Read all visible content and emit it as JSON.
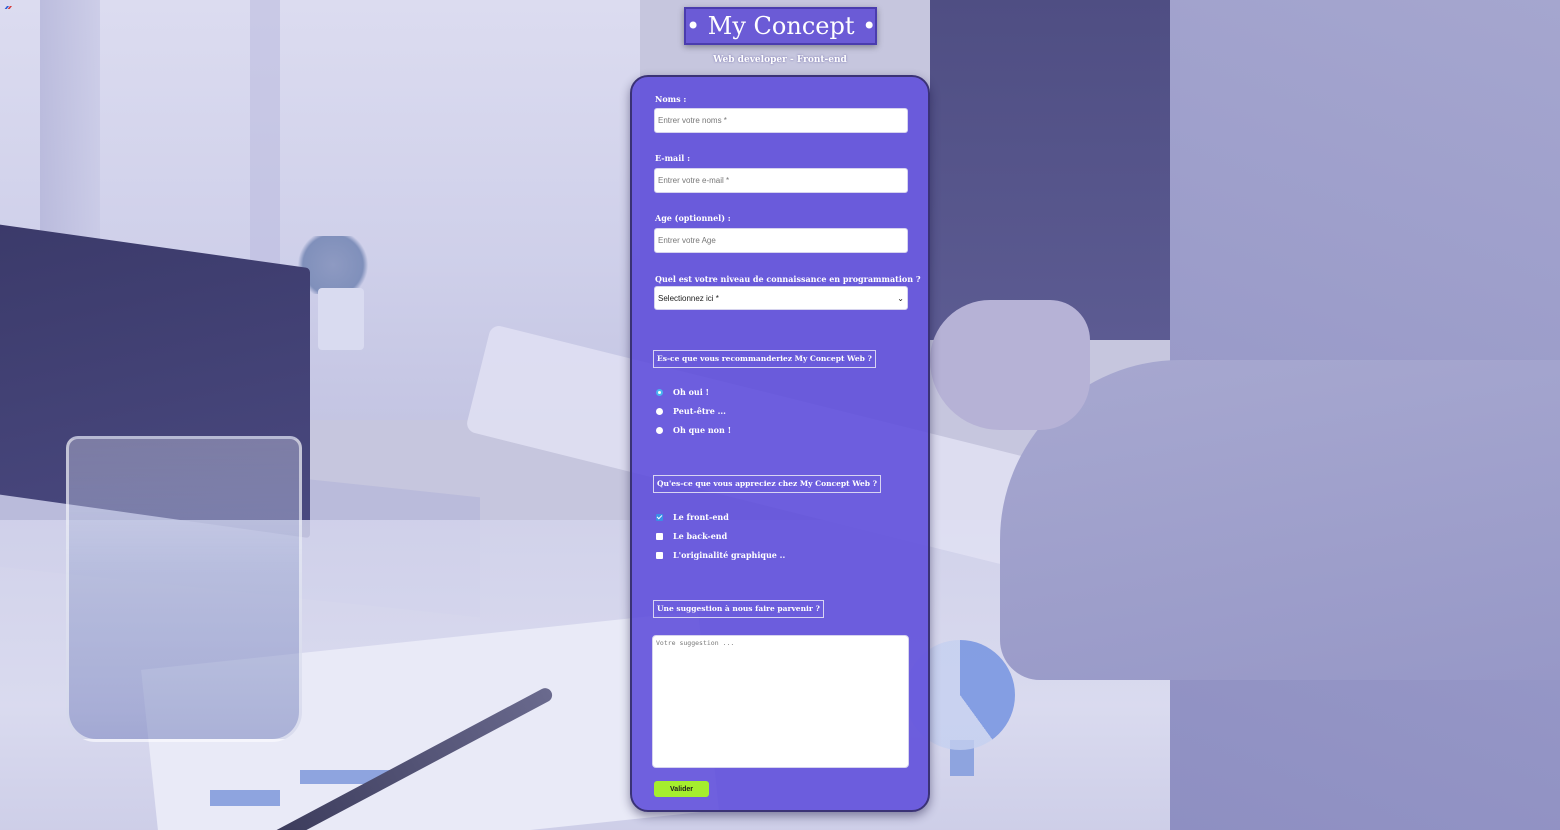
{
  "brand": {
    "title": "• My Concept •",
    "subtitle": "Web developer - Front-end"
  },
  "form": {
    "name": {
      "label": "Noms :",
      "placeholder": "Entrer votre noms *",
      "value": ""
    },
    "email": {
      "label": "E-mail :",
      "placeholder": "Entrer votre e-mail *",
      "value": ""
    },
    "age": {
      "label": "Age (optionnel) :",
      "placeholder": "Entrer votre Age",
      "value": ""
    },
    "level": {
      "label": "Quel est votre niveau de connaissance en programmation ?",
      "selected": "Selectionnez ici *"
    },
    "recommend": {
      "question": "Es-ce que vous recommanderiez My Concept Web ?",
      "options": [
        {
          "label": "Oh oui !",
          "checked": true
        },
        {
          "label": "Peut-être ...",
          "checked": false
        },
        {
          "label": "Oh que non !",
          "checked": false
        }
      ]
    },
    "appreciate": {
      "question": "Qu'es-ce que vous appreciez chez My Concept Web ?",
      "options": [
        {
          "label": "Le front-end",
          "checked": true
        },
        {
          "label": "Le back-end",
          "checked": false
        },
        {
          "label": "L'originalité graphique ..",
          "checked": false
        }
      ]
    },
    "suggestion": {
      "question": "Une suggestion à nous faire parvenir ?",
      "placeholder": "Votre suggestion ...",
      "value": ""
    },
    "submit_label": "Valider"
  },
  "colors": {
    "card": "#5d4cdb",
    "brand_box": "#6b5bd6",
    "submit": "#a5ee2e",
    "radio_checked": "#49b5f0",
    "checkbox_checked": "#3a8fe6"
  },
  "icons": {
    "select_chevron": "chevron-down-icon",
    "corner": "flag-icon"
  }
}
